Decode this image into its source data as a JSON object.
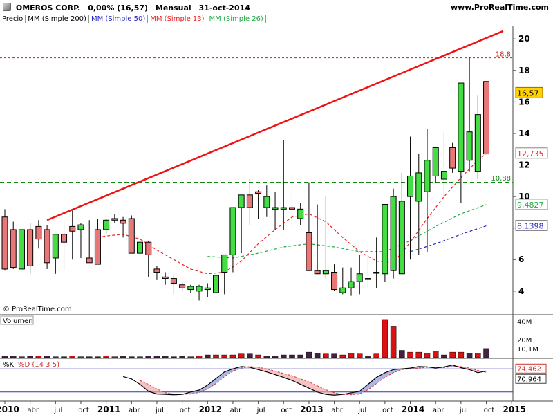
{
  "header": {
    "symbol": "OMEROS CORP.",
    "change": "0,00% (16,57)",
    "period": "Mensual",
    "date": "31-oct-2014",
    "site": "www.ProRealTime.com"
  },
  "legend": {
    "price": "Precio",
    "ma200": "MM (Simple 200)",
    "ma50": "MM (Simple 50)",
    "ma13": "MM (Simple 13)",
    "ma26": "MM (Simple 26)"
  },
  "copyright": "© ProRealTime.com",
  "colors": {
    "up_candle": "#44dd44",
    "down_candle": "#e87878",
    "ma13": "#ee2222",
    "ma26": "#22aa44",
    "ma50": "#2222bb",
    "trendline": "#ee1111",
    "support": "#118811",
    "resistance": "#cc2222",
    "axis_bg": "#ffffff"
  },
  "chart_data": [
    {
      "type": "candlestick",
      "title": "OMEROS CORP.",
      "x": [
        "2010-01",
        "2010-02",
        "2010-03",
        "2010-04",
        "2010-05",
        "2010-06",
        "2010-07",
        "2010-08",
        "2010-09",
        "2010-10",
        "2010-11",
        "2010-12",
        "2011-01",
        "2011-02",
        "2011-03",
        "2011-04",
        "2011-05",
        "2011-06",
        "2011-07",
        "2011-08",
        "2011-09",
        "2011-10",
        "2011-11",
        "2011-12",
        "2012-01",
        "2012-02",
        "2012-03",
        "2012-04",
        "2012-05",
        "2012-06",
        "2012-07",
        "2012-08",
        "2012-09",
        "2012-10",
        "2012-11",
        "2012-12",
        "2013-01",
        "2013-02",
        "2013-03",
        "2013-04",
        "2013-05",
        "2013-06",
        "2013-07",
        "2013-08",
        "2013-09",
        "2013-10",
        "2013-11",
        "2013-12",
        "2014-01",
        "2014-02",
        "2014-03",
        "2014-04",
        "2014-05",
        "2014-06",
        "2014-07",
        "2014-08",
        "2014-09",
        "2014-10"
      ],
      "open": [
        8.7,
        7.9,
        5.4,
        7.9,
        8.1,
        7.9,
        6.1,
        7.6,
        8.1,
        7.9,
        6.1,
        7.9,
        7.9,
        8.5,
        8.5,
        8.6,
        6.4,
        7.1,
        5.4,
        4.9,
        4.8,
        4.4,
        4.1,
        4.0,
        4.1,
        3.9,
        5.2,
        6.3,
        9.3,
        10.1,
        10.3,
        9.3,
        9.2,
        9.2,
        9.3,
        8.6,
        7.7,
        5.3,
        5.1,
        5.2,
        3.9,
        4.2,
        4.6,
        4.8,
        5.2,
        5.1,
        5.3,
        5.1,
        10.0,
        9.7,
        10.3,
        11.3,
        11.1,
        13.1,
        11.6,
        12.3,
        11.6,
        17.3
      ],
      "high": [
        9.2,
        8.4,
        7.9,
        8.3,
        8.5,
        8.2,
        7.5,
        8.4,
        9.1,
        8.3,
        8.5,
        8.6,
        8.6,
        8.9,
        8.7,
        8.8,
        7.1,
        7.2,
        5.6,
        5.2,
        5.0,
        4.6,
        4.4,
        4.4,
        4.5,
        4.3,
        5.4,
        6.7,
        9.8,
        11.1,
        10.4,
        10.7,
        10.3,
        13.6,
        10.6,
        9.6,
        10.9,
        9.5,
        10.0,
        5.7,
        5.5,
        5.5,
        6.3,
        6.3,
        7.4,
        5.6,
        10.5,
        11.5,
        13.8,
        12.7,
        14.3,
        12.9,
        14.1,
        13.4,
        17.2,
        18.8,
        16.4,
        16.8
      ],
      "low": [
        5.3,
        5.4,
        5.4,
        5.1,
        6.7,
        5.4,
        5.1,
        5.3,
        6.0,
        6.1,
        5.8,
        7.6,
        7.6,
        8.3,
        7.4,
        6.4,
        6.2,
        4.9,
        4.7,
        4.4,
        3.8,
        4.0,
        3.9,
        3.4,
        3.6,
        3.4,
        3.8,
        5.2,
        6.4,
        8.2,
        8.6,
        8.7,
        7.9,
        7.9,
        8.0,
        8.2,
        6.0,
        5.1,
        4.8,
        4.0,
        3.8,
        3.7,
        3.8,
        4.2,
        4.2,
        4.6,
        4.8,
        5.1,
        6.0,
        6.3,
        6.5,
        10.9,
        9.9,
        11.5,
        9.6,
        11.6,
        11.1,
        13.6
      ],
      "close": [
        5.4,
        5.5,
        7.9,
        5.6,
        7.3,
        5.8,
        7.6,
        7.1,
        7.8,
        8.2,
        5.8,
        5.7,
        8.5,
        8.6,
        8.3,
        6.4,
        7.1,
        6.3,
        5.2,
        4.8,
        4.5,
        4.2,
        4.3,
        4.3,
        4.2,
        5.0,
        6.3,
        9.3,
        10.1,
        9.3,
        10.2,
        10.0,
        9.3,
        9.3,
        9.2,
        9.2,
        5.3,
        5.1,
        5.3,
        4.1,
        4.2,
        4.6,
        5.1,
        4.8,
        5.2,
        9.5,
        10.0,
        9.7,
        11.3,
        11.5,
        12.3,
        13.1,
        11.6,
        11.8,
        17.2,
        14.1,
        15.2,
        12.7
      ]
    },
    {
      "type": "line",
      "name": "MM (Simple 13)",
      "x": [
        "2010-12",
        "2011-01",
        "2011-03",
        "2011-05",
        "2011-07",
        "2011-09",
        "2011-11",
        "2012-01",
        "2012-03",
        "2012-05",
        "2012-07",
        "2012-09",
        "2012-11",
        "2013-01",
        "2013-03",
        "2013-05",
        "2013-07",
        "2013-09",
        "2013-11",
        "2014-01",
        "2014-03",
        "2014-05",
        "2014-07",
        "2014-09",
        "2014-10"
      ],
      "values": [
        7.4,
        7.5,
        7.6,
        7.3,
        6.6,
        6.0,
        5.4,
        5.1,
        5.2,
        5.9,
        7.0,
        7.9,
        8.7,
        8.9,
        8.4,
        7.4,
        6.5,
        5.9,
        5.8,
        7.1,
        8.6,
        10.0,
        11.2,
        12.3,
        12.73
      ]
    },
    {
      "type": "line",
      "name": "MM (Simple 26)",
      "x": [
        "2012-01",
        "2012-04",
        "2012-07",
        "2012-10",
        "2013-01",
        "2013-04",
        "2013-07",
        "2013-10",
        "2014-01",
        "2014-04",
        "2014-07",
        "2014-10"
      ],
      "values": [
        6.2,
        6.1,
        6.4,
        6.8,
        7.0,
        6.8,
        6.5,
        6.5,
        7.2,
        8.1,
        8.9,
        9.4827
      ]
    },
    {
      "type": "line",
      "name": "MM (Simple 50)",
      "x": [
        "2014-01",
        "2014-04",
        "2014-07",
        "2014-10"
      ],
      "values": [
        6.5,
        7.0,
        7.6,
        8.1398
      ]
    },
    {
      "type": "line",
      "name": "trendline",
      "x": [
        "2010-06",
        "2014-12"
      ],
      "values": [
        8.5,
        20.5
      ]
    }
  ],
  "price_axis": {
    "ticks": [
      "20",
      "18",
      "16",
      "14",
      "12",
      "10",
      "8",
      "6",
      "4"
    ],
    "tick_values": [
      20,
      18,
      16,
      14,
      12,
      10,
      8,
      6,
      4
    ],
    "ylim": [
      2.5,
      20.8
    ],
    "resistance": {
      "value": 18.8,
      "label": "18,8"
    },
    "support": {
      "value": 10.88,
      "label": "10,88"
    },
    "last_price": {
      "value": 16.57,
      "label": "16,57"
    },
    "ma13_label": {
      "value": 12.735,
      "label": "12,735"
    },
    "ma26_label": {
      "value": 9.4827,
      "label": "9,4827"
    },
    "ma50_label": {
      "value": 8.1398,
      "label": "8,1398"
    }
  },
  "volume_panel": {
    "title": "Volumen",
    "ticks": [
      "40M",
      "20M",
      "10,1M"
    ],
    "tick_values": [
      40,
      20,
      10.1
    ],
    "ylim": [
      0,
      45
    ],
    "values": [
      2,
      2,
      1,
      2,
      2,
      2,
      1,
      1,
      2,
      1,
      1,
      1,
      2,
      1,
      2,
      1,
      1,
      2,
      2,
      2,
      1,
      2,
      1,
      2,
      3,
      3,
      3,
      3,
      4,
      4,
      3,
      2,
      2,
      3,
      3,
      3,
      6,
      5,
      4,
      4,
      3,
      5,
      4,
      2,
      4,
      42,
      34,
      8,
      6,
      6,
      5,
      7,
      3,
      6,
      6,
      5,
      5,
      10
    ],
    "up_flags": [
      0,
      0,
      1,
      0,
      1,
      0,
      1,
      0,
      1,
      1,
      0,
      0,
      1,
      1,
      0,
      0,
      1,
      0,
      0,
      0,
      0,
      0,
      1,
      1,
      0,
      1,
      1,
      1,
      1,
      0,
      1,
      0,
      0,
      0,
      0,
      0,
      0,
      0,
      1,
      0,
      1,
      1,
      1,
      0,
      1,
      1,
      1,
      0,
      1,
      1,
      1,
      1,
      0,
      1,
      1,
      0,
      1,
      0
    ]
  },
  "stoch_panel": {
    "label_k": "%K",
    "label_d": "%D (14 3 5)",
    "ticks": [
      "74,462",
      "70,964"
    ],
    "tick_values": [
      74.462,
      70.964
    ],
    "levels": [
      80,
      20
    ],
    "k": [
      null,
      null,
      null,
      null,
      null,
      null,
      null,
      null,
      null,
      null,
      null,
      null,
      null,
      null,
      60,
      54,
      40,
      22,
      15,
      14,
      13,
      14,
      20,
      25,
      38,
      55,
      72,
      80,
      86,
      84,
      78,
      72,
      65,
      58,
      50,
      40,
      30,
      20,
      14,
      12,
      14,
      18,
      22,
      40,
      58,
      70,
      78,
      80,
      82,
      86,
      85,
      82,
      85,
      90,
      83,
      78,
      70,
      74.462
    ],
    "d": [
      null,
      null,
      null,
      null,
      null,
      null,
      null,
      null,
      null,
      null,
      null,
      null,
      null,
      null,
      null,
      null,
      50,
      40,
      28,
      18,
      15,
      14,
      15,
      19,
      28,
      42,
      60,
      74,
      82,
      86,
      84,
      80,
      74,
      68,
      62,
      54,
      46,
      36,
      26,
      18,
      14,
      13,
      15,
      26,
      42,
      58,
      70,
      78,
      80,
      82,
      84,
      84,
      83,
      86,
      86,
      82,
      76,
      70.964
    ]
  },
  "x_axis": {
    "labels": [
      "2010",
      "abr",
      "jul",
      "oct",
      "2011",
      "abr",
      "jul",
      "oct",
      "2012",
      "abr",
      "jul",
      "oct",
      "2013",
      "abr",
      "jul",
      "oct",
      "2014",
      "abr",
      "jul",
      "oct",
      "2015"
    ],
    "label_months": [
      "2010-01",
      "2010-04",
      "2010-07",
      "2010-10",
      "2011-01",
      "2011-04",
      "2011-07",
      "2011-10",
      "2012-01",
      "2012-04",
      "2012-07",
      "2012-10",
      "2013-01",
      "2013-04",
      "2013-07",
      "2013-10",
      "2014-01",
      "2014-04",
      "2014-07",
      "2014-10",
      "2015-01"
    ],
    "bold": [
      "2010",
      "2011",
      "2012",
      "2013",
      "2014",
      "2015"
    ]
  }
}
